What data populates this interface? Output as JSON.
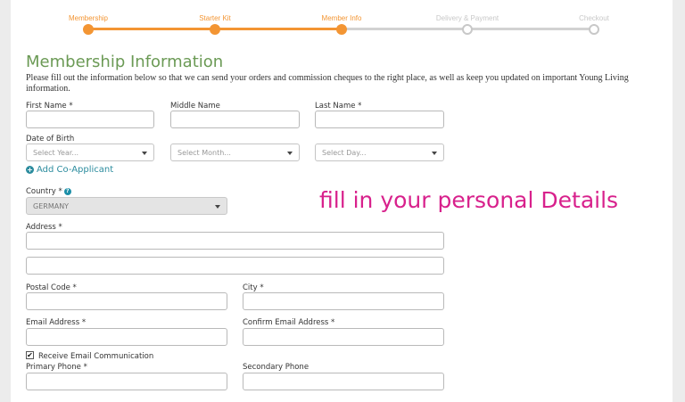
{
  "steps": [
    {
      "label": "Membership",
      "state": "done"
    },
    {
      "label": "Starter Kit",
      "state": "done"
    },
    {
      "label": "Member Info",
      "state": "done"
    },
    {
      "label": "Delivery & Payment",
      "state": "todo"
    },
    {
      "label": "Checkout",
      "state": "todo"
    }
  ],
  "colors": {
    "accent": "#f39533",
    "title": "#6b9a55",
    "link": "#2c8c9e",
    "annotation": "#d8218c"
  },
  "section": {
    "title": "Membership Information",
    "intro": "Please fill out the information below so that we can send your orders and commission cheques to the right place, as well as keep you updated on important Young Living information."
  },
  "fields": {
    "first_name": "First Name *",
    "middle_name": "Middle Name",
    "last_name": "Last Name *",
    "dob": "Date of Birth",
    "select_year": "Select Year...",
    "select_month": "Select Month...",
    "select_day": "Select Day...",
    "add_co_applicant": "Add Co-Applicant",
    "country": "Country *",
    "country_value": "GERMANY",
    "address": "Address *",
    "postal_code": "Postal Code *",
    "city": "City *",
    "email": "Email Address *",
    "confirm_email": "Confirm Email Address *",
    "receive_email": "Receive Email Communication",
    "receive_email_checked": true,
    "primary_phone": "Primary Phone *",
    "secondary_phone": "Secondary Phone"
  },
  "annotation": "fill in your personal Details"
}
